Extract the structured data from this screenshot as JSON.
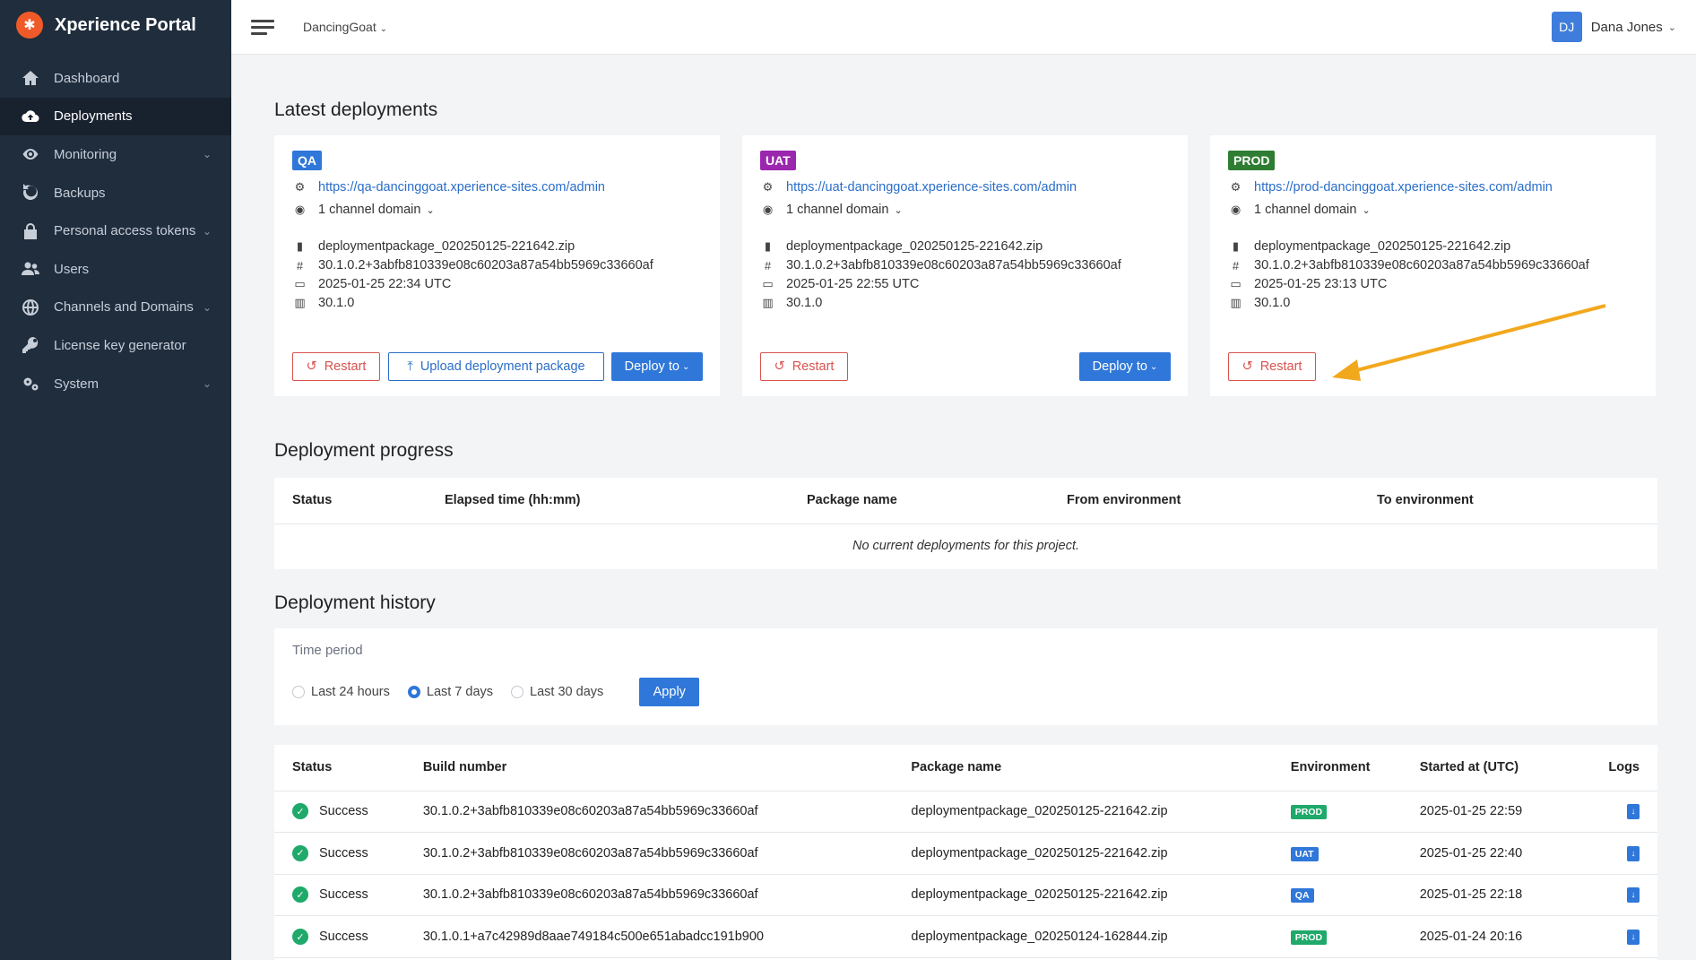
{
  "app": {
    "title": "Xperience Portal"
  },
  "sidebar": {
    "items": [
      {
        "label": "Dashboard",
        "icon": "home-icon",
        "active": false,
        "expandable": false
      },
      {
        "label": "Deployments",
        "icon": "cloud-upload-icon",
        "active": true,
        "expandable": false
      },
      {
        "label": "Monitoring",
        "icon": "eye-icon",
        "active": false,
        "expandable": true
      },
      {
        "label": "Backups",
        "icon": "backup-icon",
        "active": false,
        "expandable": false
      },
      {
        "label": "Personal access tokens",
        "icon": "lock-icon",
        "active": false,
        "expandable": true
      },
      {
        "label": "Users",
        "icon": "users-icon",
        "active": false,
        "expandable": false
      },
      {
        "label": "Channels and Domains",
        "icon": "globe-icon",
        "active": false,
        "expandable": true
      },
      {
        "label": "License key generator",
        "icon": "key-icon",
        "active": false,
        "expandable": false
      },
      {
        "label": "System",
        "icon": "gears-icon",
        "active": false,
        "expandable": true
      }
    ]
  },
  "topbar": {
    "project": "DancingGoat",
    "user_initials": "DJ",
    "user_name": "Dana Jones"
  },
  "latest": {
    "title": "Latest deployments",
    "cards": [
      {
        "env": "QA",
        "color": "#2f77d9",
        "url": "https://qa-dancinggoat.xperience-sites.com/admin",
        "domains": "1 channel domain",
        "package": "deploymentpackage_020250125-221642.zip",
        "build": "30.1.0.2+3abfb810339e08c60203a87a54bb5969c33660af",
        "date": "2025-01-25 22:34 UTC",
        "version": "30.1.0",
        "restart": "Restart",
        "upload": "Upload deployment package",
        "deploy": "Deploy to"
      },
      {
        "env": "UAT",
        "color": "#9b27af",
        "url": "https://uat-dancinggoat.xperience-sites.com/admin",
        "domains": "1 channel domain",
        "package": "deploymentpackage_020250125-221642.zip",
        "build": "30.1.0.2+3abfb810339e08c60203a87a54bb5969c33660af",
        "date": "2025-01-25 22:55 UTC",
        "version": "30.1.0",
        "restart": "Restart",
        "deploy": "Deploy to"
      },
      {
        "env": "PROD",
        "color": "#2e7d32",
        "url": "https://prod-dancinggoat.xperience-sites.com/admin",
        "domains": "1 channel domain",
        "package": "deploymentpackage_020250125-221642.zip",
        "build": "30.1.0.2+3abfb810339e08c60203a87a54bb5969c33660af",
        "date": "2025-01-25 23:13 UTC",
        "version": "30.1.0",
        "restart": "Restart"
      }
    ]
  },
  "progress": {
    "title": "Deployment progress",
    "columns": [
      "Status",
      "Elapsed time (hh:mm)",
      "Package name",
      "From environment",
      "To environment"
    ],
    "empty": "No current deployments for this project."
  },
  "history": {
    "title": "Deployment history",
    "period_label": "Time period",
    "options": [
      "Last 24 hours",
      "Last 7 days",
      "Last 30 days"
    ],
    "selected": "Last 7 days",
    "apply": "Apply",
    "columns": [
      "Status",
      "Build number",
      "Package name",
      "Environment",
      "Started at (UTC)",
      "Logs"
    ],
    "rows": [
      {
        "status": "Success",
        "build": "30.1.0.2+3abfb810339e08c60203a87a54bb5969c33660af",
        "package": "deploymentpackage_020250125-221642.zip",
        "env": "PROD",
        "env_color": "#1fa96a",
        "started": "2025-01-25 22:59"
      },
      {
        "status": "Success",
        "build": "30.1.0.2+3abfb810339e08c60203a87a54bb5969c33660af",
        "package": "deploymentpackage_020250125-221642.zip",
        "env": "UAT",
        "env_color": "#2f77d9",
        "started": "2025-01-25 22:40"
      },
      {
        "status": "Success",
        "build": "30.1.0.2+3abfb810339e08c60203a87a54bb5969c33660af",
        "package": "deploymentpackage_020250125-221642.zip",
        "env": "QA",
        "env_color": "#2f77d9",
        "started": "2025-01-25 22:18"
      },
      {
        "status": "Success",
        "build": "30.1.0.1+a7c42989d8aae749184c500e651abadcc191b900",
        "package": "deploymentpackage_020250124-162844.zip",
        "env": "PROD",
        "env_color": "#1fa96a",
        "started": "2025-01-24 20:16"
      }
    ]
  }
}
